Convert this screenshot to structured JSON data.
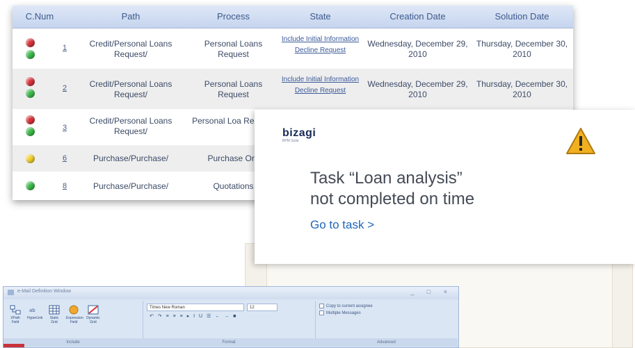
{
  "table": {
    "headers": [
      "C.Num",
      "Path",
      "Process",
      "State",
      "Creation Date",
      "Solution Date"
    ],
    "rows": [
      {
        "status": [
          "red",
          "green"
        ],
        "num": "1",
        "path": "Credit/Personal Loans Request/",
        "process": "Personal Loans Request",
        "state_links": [
          "Include Initial Information",
          "Decline Request"
        ],
        "creation": "Wednesday, December 29, 2010",
        "solution": "Thursday, December 30, 2010"
      },
      {
        "status": [
          "red",
          "green"
        ],
        "num": "2",
        "path": "Credit/Personal Loans Request/",
        "process": "Personal Loans Request",
        "state_links": [
          "Include Initial Information",
          "Decline Request"
        ],
        "creation": "Wednesday, December 29, 2010",
        "solution": "Thursday, December 30, 2010"
      },
      {
        "status": [
          "red",
          "green"
        ],
        "num": "3",
        "path": "Credit/Personal Loans Request/",
        "process": "Personal Loa Request",
        "state_links": [],
        "creation": "",
        "solution": ""
      },
      {
        "status": [
          "yellow"
        ],
        "num": "6",
        "path": "Purchase/Purchase/",
        "process": "Purchase Ord",
        "state_links": [],
        "creation": "",
        "solution": ""
      },
      {
        "status": [
          "green"
        ],
        "num": "8",
        "path": "Purchase/Purchase/",
        "process": "Quotations",
        "state_links": [],
        "creation": "",
        "solution": ""
      }
    ]
  },
  "notification": {
    "brand": "bizagi",
    "brand_sub": "BPM Suite",
    "icon": "warning-icon",
    "message_line1": "Task “Loan analysis”",
    "message_line2": "not completed on time",
    "action": "Go to task >"
  },
  "ribbon": {
    "title": "e-Mail Definition Window",
    "window_buttons": "_ □ ×",
    "include_items": [
      "XPath Field",
      "HyperLink",
      "Static Grid",
      "Expression Field",
      "Dynamic Grid"
    ],
    "include_label": "Include",
    "font_name": "Times New Roman",
    "font_size": "12",
    "format_label": "Format",
    "format_tools": "↶ ↷ ≡ ≡ ≡ ▸ I U ☰ ← → ■",
    "checks": [
      "Copy to current assignee",
      "Multiple Messages"
    ],
    "advanced_label": "Advanced"
  },
  "colors": {
    "header_text": "#3d5a8c",
    "link": "#1e66b8",
    "status_red": "#d8323a",
    "status_green": "#3cb94a",
    "status_yellow": "#f2d02c",
    "warning": "#f0b020"
  }
}
